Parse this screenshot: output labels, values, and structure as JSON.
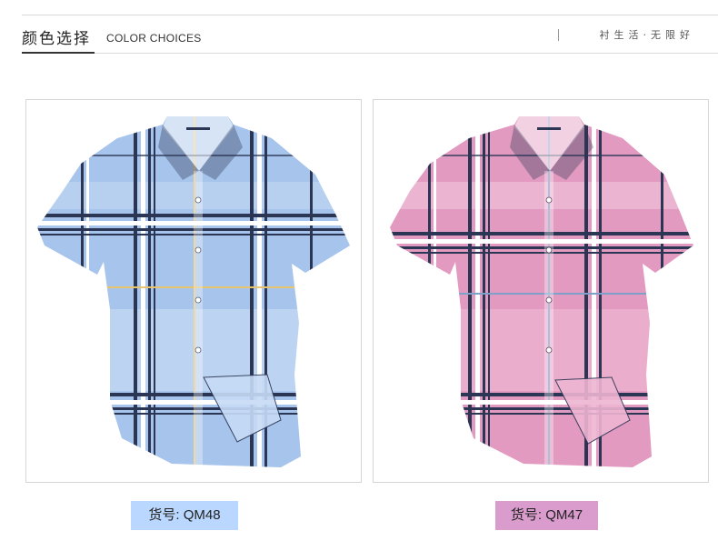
{
  "header": {
    "title_cn": "颜色选择",
    "title_en": "COLOR CHOICES",
    "slogan": "衬生活·无限好"
  },
  "products": [
    {
      "label": "货号: QM48",
      "color_name": "blue plaid",
      "base": "#a6c4ec",
      "tag_bg": "#bad8ff"
    },
    {
      "label": "货号: QM47",
      "color_name": "pink plaid",
      "base": "#e39ac0",
      "tag_bg": "#d99ccd"
    }
  ],
  "colors": {
    "stripe_dark": "#2b3654",
    "stripe_light": "#ffffff"
  }
}
